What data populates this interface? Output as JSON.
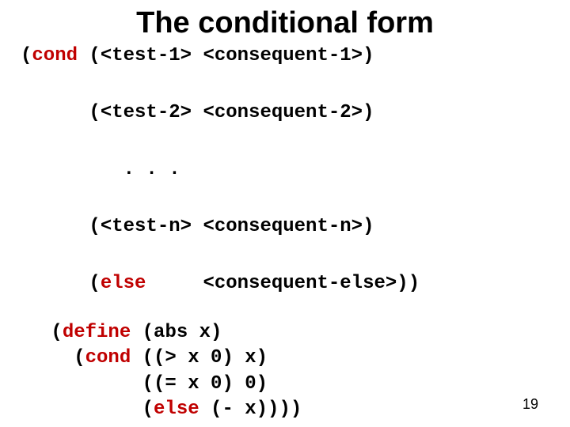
{
  "title": "The conditional form",
  "syntax": {
    "line1_a": "(",
    "line1_kw": "cond",
    "line1_b": " (<test-1> <consequent-1>)",
    "line2": "      (<test-2> <consequent-2>)",
    "line3": "         . . .",
    "line4": "      (<test-n> <consequent-n>)",
    "line5_a": "      (",
    "line5_kw": "else",
    "line5_b": "     <consequent-else>))"
  },
  "example": {
    "l1_a": " (",
    "l1_kw": "define",
    "l1_b": " (abs x)",
    "l2_a": "   (",
    "l2_kw": "cond",
    "l2_b": " ((> x 0) x)",
    "l3": "         ((= x 0) 0)",
    "l4_a": "         (",
    "l4_kw": "else",
    "l4_b": " (- x))))"
  },
  "page_number": "19"
}
